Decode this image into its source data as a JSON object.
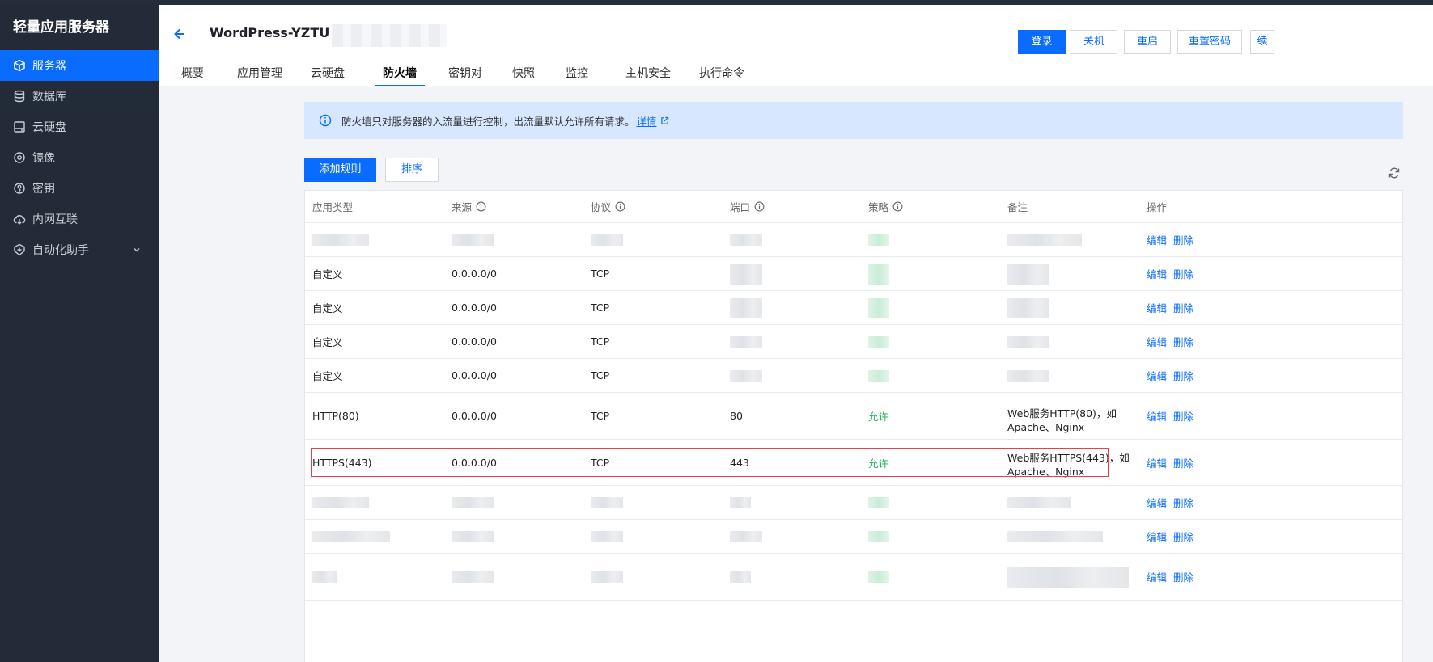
{
  "app": {
    "title": "轻量应用服务器"
  },
  "sidebar": {
    "items": [
      {
        "label": "服务器",
        "icon": "cube-icon",
        "active": true
      },
      {
        "label": "数据库",
        "icon": "database-icon",
        "active": false
      },
      {
        "label": "云硬盘",
        "icon": "disk-icon",
        "active": false
      },
      {
        "label": "镜像",
        "icon": "image-icon",
        "active": false
      },
      {
        "label": "密钥",
        "icon": "key-icon",
        "active": false
      },
      {
        "label": "内网互联",
        "icon": "cloud-link-icon",
        "active": false
      },
      {
        "label": "自动化助手",
        "icon": "automation-icon",
        "active": false,
        "expandable": true
      }
    ]
  },
  "header": {
    "instance_name": "WordPress-YZTU",
    "buttons": [
      {
        "label": "登录",
        "primary": true
      },
      {
        "label": "关机",
        "primary": false
      },
      {
        "label": "重启",
        "primary": false
      },
      {
        "label": "重置密码",
        "primary": false
      },
      {
        "label": "续",
        "primary": false
      }
    ],
    "tabs": [
      "概要",
      "应用管理",
      "云硬盘",
      "防火墙",
      "密钥对",
      "快照",
      "监控",
      "主机安全",
      "执行命令"
    ],
    "active_tab": "防火墙"
  },
  "alert": {
    "text": "防火墙只对服务器的入流量进行控制，出流量默认允许所有请求。",
    "link_label": "详情"
  },
  "toolbar": {
    "add_label": "添加规则",
    "sort_label": "排序"
  },
  "table": {
    "columns": [
      {
        "label": "应用类型",
        "help": false
      },
      {
        "label": "来源",
        "help": true
      },
      {
        "label": "协议",
        "help": true
      },
      {
        "label": "端口",
        "help": true
      },
      {
        "label": "策略",
        "help": true
      },
      {
        "label": "备注",
        "help": false
      },
      {
        "label": "操作",
        "help": false
      }
    ],
    "edit_label": "编辑",
    "delete_label": "删除",
    "rows": [
      {
        "type": "",
        "source": "",
        "protocol": "",
        "port": "",
        "policy": "",
        "remark": "",
        "masked": true
      },
      {
        "type": "自定义",
        "source": "0.0.0.0/0",
        "protocol": "TCP",
        "port": "",
        "policy": "",
        "remark": "",
        "masked": false
      },
      {
        "type": "自定义",
        "source": "0.0.0.0/0",
        "protocol": "TCP",
        "port": "",
        "policy": "",
        "remark": "",
        "masked": false
      },
      {
        "type": "自定义",
        "source": "0.0.0.0/0",
        "protocol": "TCP",
        "port": "",
        "policy": "",
        "remark": "",
        "masked": false
      },
      {
        "type": "自定义",
        "source": "0.0.0.0/0",
        "protocol": "TCP",
        "port": "",
        "policy": "",
        "remark": "",
        "masked": false
      },
      {
        "type": "HTTP(80)",
        "source": "0.0.0.0/0",
        "protocol": "TCP",
        "port": "80",
        "policy": "允许",
        "remark_line1": "Web服务HTTP(80)，如",
        "remark_line2": "Apache、Nginx",
        "masked": false
      },
      {
        "type": "HTTPS(443)",
        "source": "0.0.0.0/0",
        "protocol": "TCP",
        "port": "443",
        "policy": "允许",
        "remark_line1": "Web服务HTTPS(443)，如",
        "remark_line2": "Apache、Nginx",
        "masked": false,
        "highlighted": true
      },
      {
        "type": "",
        "source": "",
        "protocol": "",
        "port": "",
        "policy": "",
        "remark": "",
        "masked": true
      },
      {
        "type": "",
        "source": "",
        "protocol": "",
        "port": "",
        "policy": "",
        "remark": "",
        "masked": true
      },
      {
        "type": "",
        "source": "",
        "protocol": "",
        "port": "",
        "policy": "",
        "remark": "",
        "masked": true
      }
    ]
  },
  "colors": {
    "accent": "#0a6cff",
    "sidebar_bg": "#242b38",
    "allow": "#1fb25a",
    "highlight": "#e8404a"
  }
}
